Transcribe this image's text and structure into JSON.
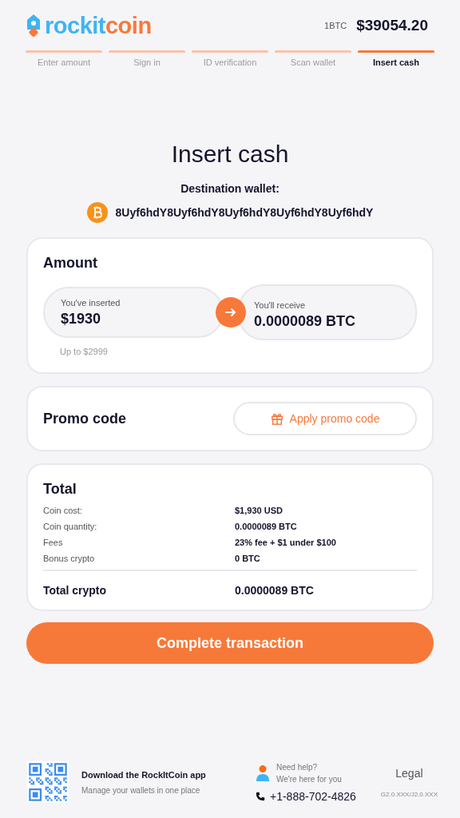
{
  "header": {
    "logo": {
      "part_1": "rockit",
      "part_2": "coin"
    },
    "rate_label": "1BTC",
    "rate_value": "$39054.20"
  },
  "steps": [
    {
      "label": "Enter amount",
      "selected": false
    },
    {
      "label": "Sign in",
      "selected": false
    },
    {
      "label": "ID verification",
      "selected": false
    },
    {
      "label": "Scan wallet",
      "selected": false
    },
    {
      "label": "Insert cash",
      "selected": true
    }
  ],
  "title": "Insert cash",
  "destination": {
    "label": "Destination wallet:",
    "address": "8Uyf6hdY8Uyf6hdY8Uyf6hdY8Uyf6hdY8Uyf6hdY"
  },
  "amount": {
    "title": "Amount",
    "inserted_label": "You've inserted",
    "inserted_value": "$1930",
    "limit": "Up to $2999",
    "receive_label": "You'll receive",
    "receive_value": "0.0000089 BTC"
  },
  "promo": {
    "title": "Promo code",
    "button": "Apply promo code"
  },
  "total": {
    "title": "Total",
    "rows": [
      {
        "label": "Coin cost:",
        "value": "$1,930 USD"
      },
      {
        "label": "Coin quantity:",
        "value": "0.0000089 BTC"
      },
      {
        "label": "Fees",
        "value": "23% fee + $1 under $100"
      },
      {
        "label": "Bonus crypto",
        "value": "0 BTC"
      }
    ],
    "total_label": "Total crypto",
    "total_value": "0.0000089 BTC"
  },
  "complete_button": "Complete transaction",
  "footer": {
    "app_title": "Download the RockItCoin app",
    "app_subtitle": "Manage your wallets in one place",
    "help_title": "Need help?",
    "help_subtitle": "We're here for you",
    "phone": "+1-888-702-4826",
    "legal": "Legal",
    "version": "G2.0.XXX/J2.0.XXX"
  }
}
